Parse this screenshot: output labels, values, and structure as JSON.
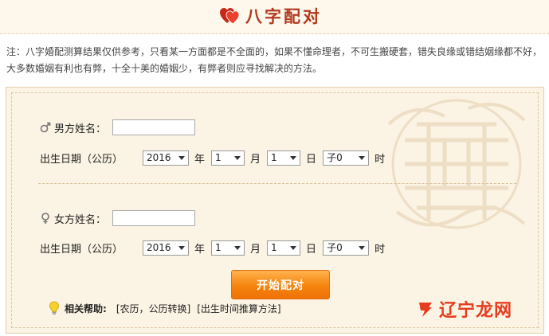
{
  "header": {
    "title": "八字配对",
    "icon": "double-heart-icon"
  },
  "note": "注：八字婚配测算结果仅供参考，只看某一方面都是不全面的，如果不懂命理者，不可生搬硬套，错失良缘或错结姻缘都不好，大多数婚姻有利也有弊，十全十美的婚姻少，有弊者则应寻找解决的方法。",
  "male": {
    "icon": "male-symbol-icon",
    "name_label": "男方姓名：",
    "name_value": "",
    "birth_label": "出生日期（公历）",
    "year": "2016",
    "year_unit": "年",
    "month": "1",
    "month_unit": "月",
    "day": "1",
    "day_unit": "日",
    "hour": "子0",
    "hour_unit": "时"
  },
  "female": {
    "icon": "female-symbol-icon",
    "name_label": "女方姓名：",
    "name_value": "",
    "birth_label": "出生日期（公历）",
    "year": "2016",
    "year_unit": "年",
    "month": "1",
    "month_unit": "月",
    "day": "1",
    "day_unit": "日",
    "hour": "子0",
    "hour_unit": "时"
  },
  "submit_label": "开始配对",
  "help": {
    "icon": "lightbulb-icon",
    "label": "相关帮助:",
    "links": [
      "[农历，公历转换]",
      "[出生时间推算方法]"
    ]
  },
  "watermark": "双喜",
  "logo": {
    "text": "辽宁龙网",
    "icon": "dragon-logo-icon",
    "color": "#e73c1e"
  },
  "colors": {
    "title": "#b23a1e",
    "button": "#f5830e",
    "panel": "#fbf3e3"
  }
}
